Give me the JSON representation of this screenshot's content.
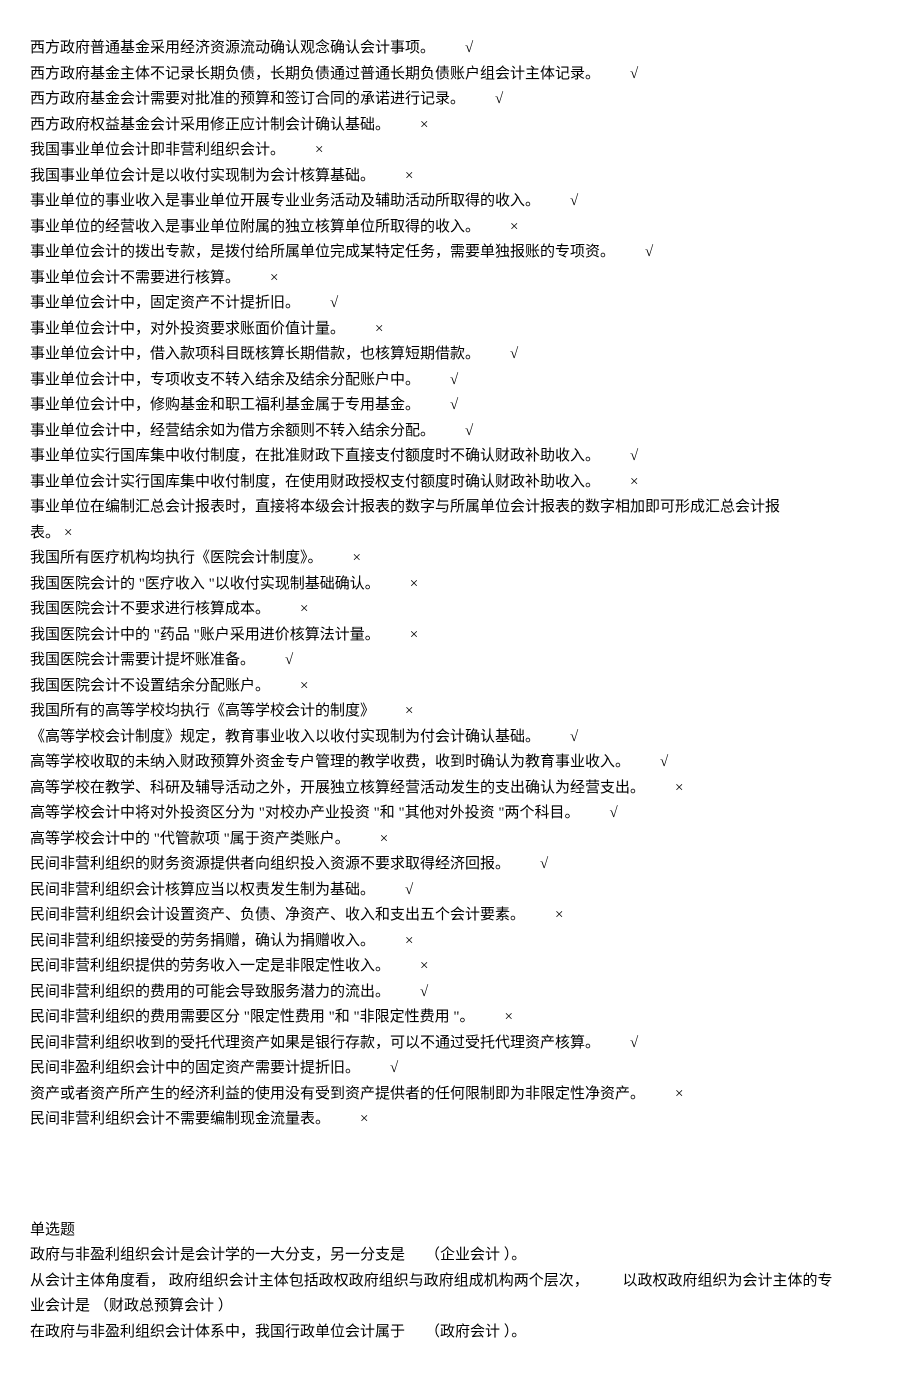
{
  "tf_statements": [
    {
      "text": "西方政府普通基金采用经济资源流动确认观念确认会计事项。",
      "mark": "√"
    },
    {
      "text": "西方政府基金主体不记录长期负债，长期负债通过普通长期负债账户组会计主体记录。",
      "mark": "√"
    },
    {
      "text": "西方政府基金会计需要对批准的预算和签订合同的承诺进行记录。",
      "mark": "√"
    },
    {
      "text": "西方政府权益基金会计采用修正应计制会计确认基础。",
      "mark": "×"
    },
    {
      "text": "我国事业单位会计即非营利组织会计。",
      "mark": "×"
    },
    {
      "text": "我国事业单位会计是以收付实现制为会计核算基础。",
      "mark": "×"
    },
    {
      "text": "事业单位的事业收入是事业单位开展专业业务活动及辅助活动所取得的收入。",
      "mark": "√"
    },
    {
      "text": "事业单位的经营收入是事业单位附属的独立核算单位所取得的收入。",
      "mark": "×"
    },
    {
      "text": "事业单位会计的拨出专款，是拨付给所属单位完成某特定任务，需要单独报账的专项资。",
      "mark": "√"
    },
    {
      "text": "事业单位会计不需要进行核算。",
      "mark": "×"
    },
    {
      "text": "事业单位会计中，固定资产不计提折旧。",
      "mark": "√"
    },
    {
      "text": "事业单位会计中，对外投资要求账面价值计量。",
      "mark": "×"
    },
    {
      "text": "事业单位会计中，借入款项科目既核算长期借款，也核算短期借款。",
      "mark": "√"
    },
    {
      "text": "事业单位会计中，专项收支不转入结余及结余分配账户中。",
      "mark": "√"
    },
    {
      "text": "事业单位会计中，修购基金和职工福利基金属于专用基金。",
      "mark": "√"
    },
    {
      "text": "事业单位会计中，经营结余如为借方余额则不转入结余分配。",
      "mark": "√"
    },
    {
      "text": "事业单位实行国库集中收付制度，在批准财政下直接支付额度时不确认财政补助收入。",
      "mark": "√"
    },
    {
      "text": "事业单位会计实行国库集中收付制度，在使用财政授权支付额度时确认财政补助收入。",
      "mark": "×"
    }
  ],
  "tf_wrap_1": {
    "line1": "事业单位在编制汇总会计报表时，直接将本级会计报表的数字与所属单位会计报表的数字相加即可形成汇总会计报",
    "line2_text": "表。",
    "line2_mark": "×"
  },
  "tf_statements_2": [
    {
      "text": "我国所有医疗机构均执行《医院会计制度》。",
      "mark": "×"
    },
    {
      "text": "我国医院会计的 \"医疗收入 \"以收付实现制基础确认。",
      "mark": "×"
    },
    {
      "text": "我国医院会计不要求进行核算成本。",
      "mark": "×"
    },
    {
      "text": "我国医院会计中的 \"药品 \"账户采用进价核算法计量。",
      "mark": "×"
    },
    {
      "text": "我国医院会计需要计提坏账准备。",
      "mark": "√"
    },
    {
      "text": "我国医院会计不设置结余分配账户。",
      "mark": "×"
    },
    {
      "text": "我国所有的高等学校均执行《高等学校会计的制度》",
      "mark": "×"
    },
    {
      "text": "《高等学校会计制度》规定，教育事业收入以收付实现制为付会计确认基础。",
      "mark": "√"
    },
    {
      "text": "高等学校收取的未纳入财政预算外资金专户管理的教学收费，收到时确认为教育事业收入。",
      "mark": "√"
    },
    {
      "text": "高等学校在教学、科研及辅导活动之外，开展独立核算经营活动发生的支出确认为经营支出。",
      "mark": "×"
    },
    {
      "text": "高等学校会计中将对外投资区分为 \"对校办产业投资 \"和 \"其他对外投资 \"两个科目。",
      "mark": "√"
    },
    {
      "text": "高等学校会计中的 \"代管款项 \"属于资产类账户。",
      "mark": "×"
    },
    {
      "text": "民间非营利组织的财务资源提供者向组织投入资源不要求取得经济回报。",
      "mark": "√"
    },
    {
      "text": "民间非营利组织会计核算应当以权责发生制为基础。",
      "mark": "√"
    },
    {
      "text": "民间非营利组织会计设置资产、负债、净资产、收入和支出五个会计要素。",
      "mark": "×"
    },
    {
      "text": "民间非营利组织接受的劳务捐赠，确认为捐赠收入。",
      "mark": "×"
    },
    {
      "text": "民间非营利组织提供的劳务收入一定是非限定性收入。",
      "mark": "×"
    },
    {
      "text": "民间非营利组织的费用的可能会导致服务潜力的流出。",
      "mark": "√"
    },
    {
      "text": "民间非营利组织的费用需要区分 \"限定性费用 \"和 \"非限定性费用 \"。",
      "mark": "×"
    },
    {
      "text": "民间非营利组织收到的受托代理资产如果是银行存款，可以不通过受托代理资产核算。",
      "mark": "√"
    },
    {
      "text": "民间非盈利组织会计中的固定资产需要计提折旧。",
      "mark": "√"
    },
    {
      "text": "资产或者资产所产生的经济利益的使用没有受到资产提供者的任何限制即为非限定性净资产。",
      "mark": "×"
    },
    {
      "text": "民间非营利组织会计不需要编制现金流量表。",
      "mark": "×"
    }
  ],
  "mc_heading": "单选题",
  "mc_items": [
    {
      "text": "政府与非盈利组织会计是会计学的一大分支，另一分支是",
      "answer": "（企业会计 ）。",
      "wrap": false
    },
    {
      "text_line1": "从会计主体角度看， 政府组织会计主体包括政权政府组织与政府组成机构两个层次， ",
      "text_line1_tail": "以政权政府组织为会计主体的专",
      "text_line2": "业会计是",
      "answer": "（财政总预算会计 ）",
      "wrap": true
    },
    {
      "text": "在政府与非盈利组织会计体系中，我国行政单位会计属于",
      "answer": "（政府会计 ）。",
      "wrap": false
    }
  ]
}
